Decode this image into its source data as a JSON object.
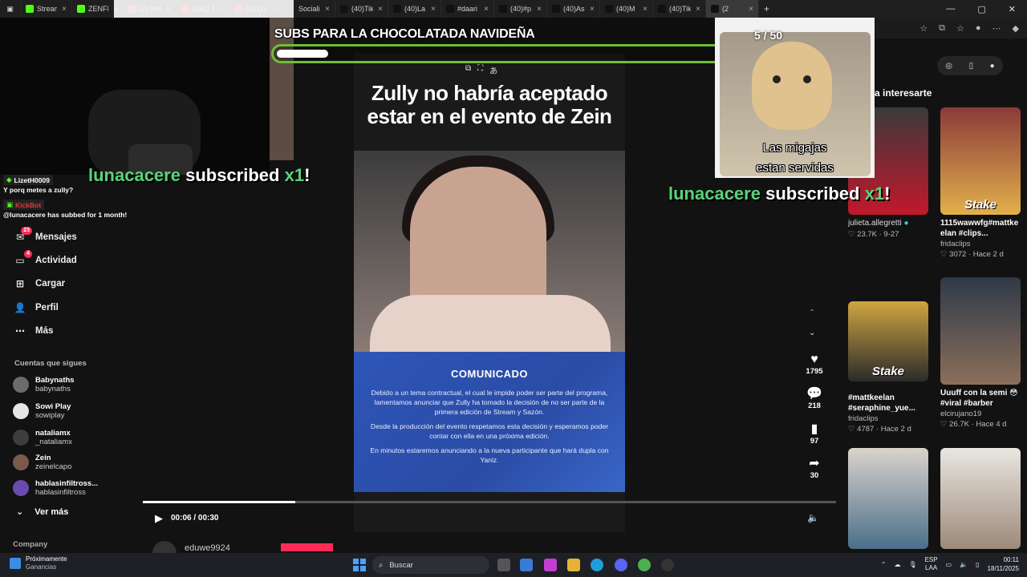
{
  "tabs": [
    {
      "label": "Stream",
      "color": "#53fc18"
    },
    {
      "label": "ZENFI",
      "color": "#53fc18"
    },
    {
      "label": "(2) Inst",
      "color": "#e1306c"
    },
    {
      "label": "(161) T",
      "color": "#ff0000"
    },
    {
      "label": "(161) p",
      "color": "#ff0000"
    },
    {
      "label": "Sociali",
      "color": "#222222"
    },
    {
      "label": "(40)Tik",
      "color": "#111111"
    },
    {
      "label": "(40)La",
      "color": "#111111"
    },
    {
      "label": "#daari",
      "color": "#111111"
    },
    {
      "label": "(40)#p",
      "color": "#111111"
    },
    {
      "label": "(40)As",
      "color": "#111111"
    },
    {
      "label": "(40)M",
      "color": "#111111"
    },
    {
      "label": "(40)Tik",
      "color": "#111111"
    },
    {
      "label": "(2",
      "color": "#111111"
    }
  ],
  "stream_overlay": {
    "goal_text": "SUBS PARA LA CHOCOLATADA NAVIDEÑA",
    "goal_count": "5 / 50",
    "goal_progress": 0.1,
    "dog_caption_line1": "Las migajas",
    "dog_caption_line2": "estan servidas",
    "sub_alert_user": "lunacacere",
    "sub_alert_middle": "subscribed",
    "sub_alert_mult": "x1",
    "sub_alert_excl": "!"
  },
  "chat": {
    "user1": "LizetH0009",
    "msg1": "Y porq metes a zully?",
    "bot_name": "KickBot",
    "bot_msg": "@lunacacere has subbed for 1 month!"
  },
  "sidebar": {
    "items": [
      {
        "label": "Mensajes",
        "icon": "inbox-icon",
        "badge": "23"
      },
      {
        "label": "Actividad",
        "icon": "activity-icon",
        "badge": "4"
      },
      {
        "label": "Cargar",
        "icon": "plus-icon",
        "badge": ""
      },
      {
        "label": "Perfil",
        "icon": "person-icon",
        "badge": ""
      },
      {
        "label": "Más",
        "icon": "more-icon",
        "badge": ""
      }
    ],
    "following_title": "Cuentas que sigues",
    "accounts": [
      {
        "name": "Babynaths",
        "handle": "babynaths"
      },
      {
        "name": "Sowi Play",
        "handle": "sowiplay"
      },
      {
        "name": "nataliamx",
        "handle": "_nataliamx"
      },
      {
        "name": "Zein",
        "handle": "zeinelcapo"
      },
      {
        "name": "hablasinfiltross...",
        "handle": "hablasinfiltross"
      }
    ],
    "see_more": "Ver más",
    "company": "Company"
  },
  "video": {
    "title_line1": "Zully no habría aceptado",
    "title_line2": "estar en el evento de Zein",
    "notice_title": "COMUNICADO",
    "notice_p1": "Debido a un tema contractual, el cual le impide poder ser parte del programa, lamentamos anunciar que Zully ha tomado la decisión de no ser parte de la primera edición de Stream y Sazón.",
    "notice_p2": "Desde la producción del evento respetamos esta decisión y esperamos poder contar con ella en una próxima edición.",
    "notice_p3": "En minutos estaremos anunciando a la nueva participante que hará dupla con Yaniz.",
    "time": "00:06 / 00:30",
    "progress": 0.22,
    "next_user": "eduwe9924"
  },
  "actions": {
    "likes": "1795",
    "comments": "218",
    "saves": "97",
    "shares": "30"
  },
  "right_column": {
    "title": "a interesarte",
    "cards": [
      {
        "caption": "julieta.allegretti",
        "author": "",
        "meta": "♡ 23.7K · 9-27",
        "verified": true
      },
      {
        "caption": "1115wawwfg#mattke elan #clips...",
        "author": "fridaclips",
        "meta": "♡ 3072 · Hace 2 d"
      },
      {
        "caption": "#mattkeelan #seraphine_yue...",
        "author": "fridaclips",
        "meta": "♡ 4787 · Hace 2 d"
      },
      {
        "caption": "Uuuff con la semi 😳 #viral #barber",
        "author": "elcirujano19",
        "meta": "♡ 26.7K · Hace 4 d"
      }
    ],
    "stake_label": "Stake"
  },
  "taskbar": {
    "weather_title": "Próximamente",
    "weather_sub": "Ganancias",
    "search_placeholder": "Buscar",
    "lang1": "ESP",
    "lang2": "LAA",
    "time": "00:11",
    "date": "18/11/2025"
  }
}
